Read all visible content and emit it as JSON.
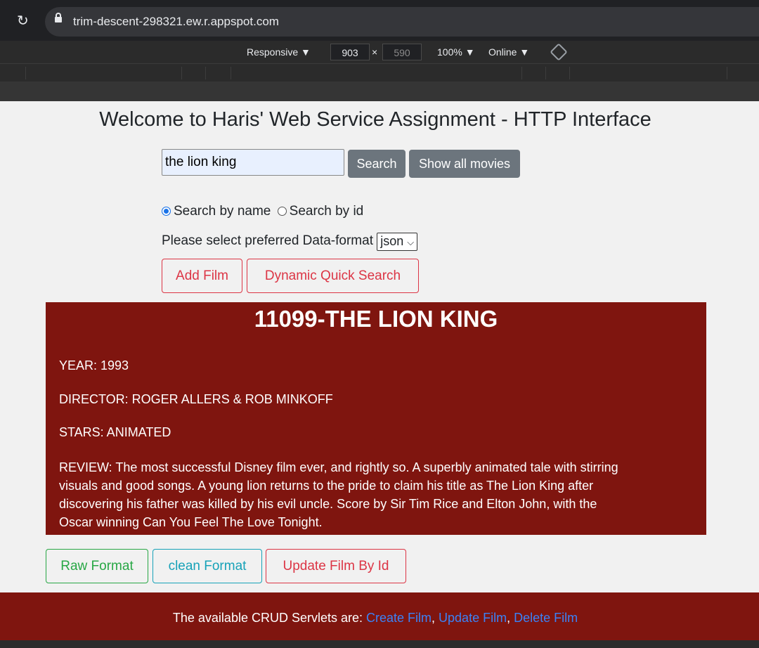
{
  "browser": {
    "url": "trim-descent-298321.ew.r.appspot.com",
    "device": "Responsive ▼",
    "width": "903",
    "times": "×",
    "height": "590",
    "zoom": "100% ▼",
    "network": "Online ▼"
  },
  "page": {
    "title": "Welcome to Haris' Web Service Assignment - HTTP Interface",
    "search": {
      "value": "the lion king",
      "search_label": "Search",
      "show_all_label": "Show all movies"
    },
    "radios": {
      "by_name": "Search by name",
      "by_id": "Search by id"
    },
    "format": {
      "label": "Please select preferred Data-format",
      "selected": "json"
    },
    "actions": {
      "add_film": "Add Film",
      "dynamic_search": "Dynamic Quick Search"
    },
    "film": {
      "heading": "11099-THE LION KING",
      "year": "YEAR: 1993",
      "director": "DIRECTOR: ROGER ALLERS & ROB MINKOFF",
      "stars": "STARS: ANIMATED",
      "review_1": "REVIEW: The most successful Disney film ever, and rightly so. A superbly animated tale with stirring",
      "review_2": "visuals and good songs. A young lion returns to the pride to claim his title as The Lion King after",
      "review_3": "discovering his father was killed by his evil uncle. Score by Sir Tim Rice and Elton John, with the",
      "review_4": "Oscar winning Can You Feel The Love Tonight."
    },
    "bottom_buttons": {
      "raw": "Raw Format",
      "clean": "clean Format",
      "update": "Update Film By Id"
    },
    "footer": {
      "prefix": "The available CRUD Servlets are: ",
      "create": "Create Film",
      "comma1": ", ",
      "update": "Update Film",
      "comma2": ", ",
      "delete": "Delete Film"
    }
  }
}
